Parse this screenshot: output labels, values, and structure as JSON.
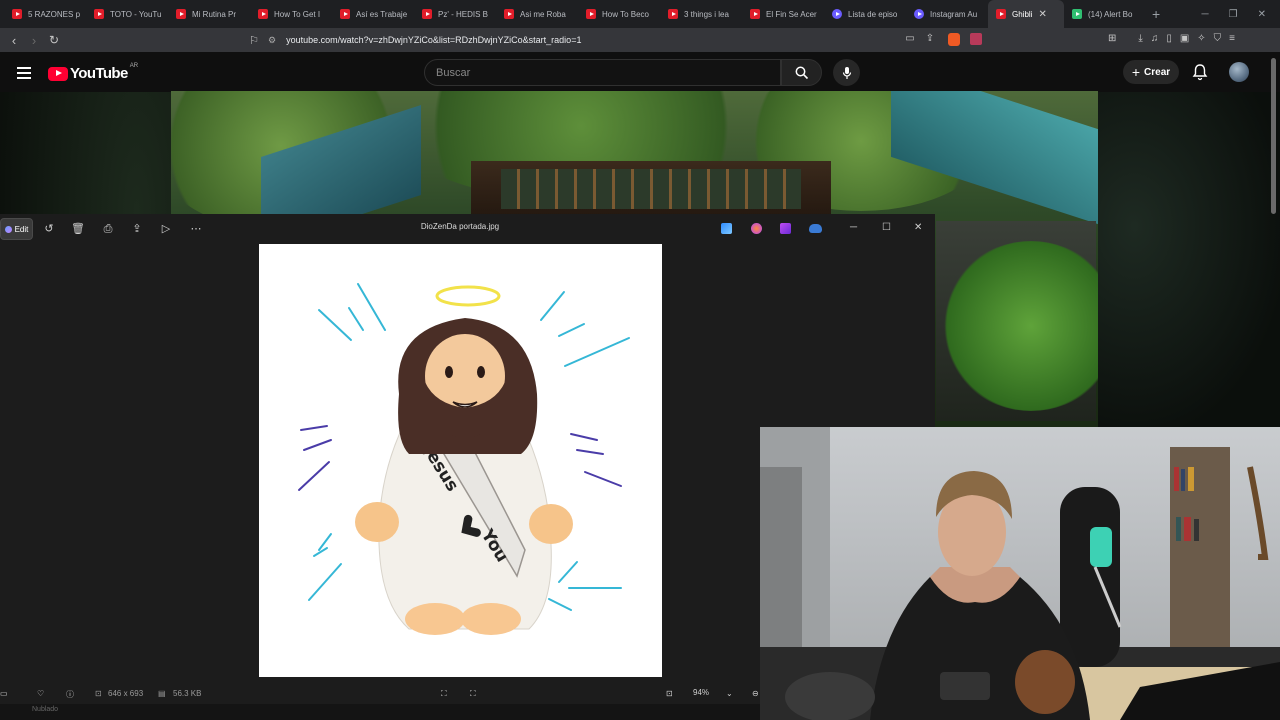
{
  "browser": {
    "tabs": [
      {
        "label": "5 RAZONES p",
        "active": false
      },
      {
        "label": "TOTO - YouTu",
        "active": false
      },
      {
        "label": "Mi Rutina Pr",
        "active": false
      },
      {
        "label": "How To Get I",
        "active": false
      },
      {
        "label": "Así es Trabaje",
        "active": false
      },
      {
        "label": "Pz' - HEDIS B",
        "active": false
      },
      {
        "label": "Asi me Roba",
        "active": false
      },
      {
        "label": "How To Beco",
        "active": false
      },
      {
        "label": "3 things i lea",
        "active": false
      },
      {
        "label": "El Fin Se Acer",
        "active": false
      },
      {
        "label": "Lista de episo",
        "active": false
      },
      {
        "label": "Instagram Au",
        "active": false
      },
      {
        "label": "Ghibli",
        "active": true
      },
      {
        "label": "(14) Alert Bo",
        "active": false
      }
    ],
    "url": "youtube.com/watch?v=zhDwjnYZiCo&list=RDzhDwjnYZiCo&start_radio=1"
  },
  "youtube": {
    "logo_text": "YouTube",
    "country_code": "AR",
    "search_placeholder": "Buscar",
    "create_label": "Crear"
  },
  "photos": {
    "edit_label": "Edit",
    "file_name": "DioZenDa portada.jpg",
    "dimensions": "646 x 693",
    "file_size": "56.3 KB",
    "zoom": "94%",
    "image": {
      "sash_text_1": "Jesus",
      "sash_text_2": "You"
    }
  },
  "taskbar": {
    "weather_text": "Nublado"
  }
}
